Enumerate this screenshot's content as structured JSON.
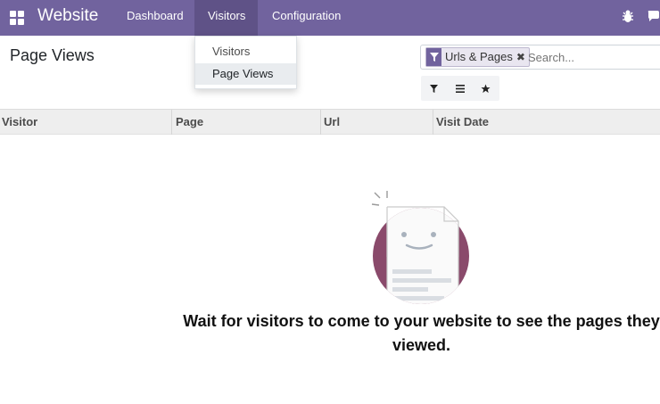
{
  "navbar": {
    "brand": "Website",
    "menu": [
      {
        "label": "Dashboard"
      },
      {
        "label": "Visitors"
      },
      {
        "label": "Configuration"
      }
    ],
    "icons": [
      "apps-grid-icon",
      "bug-icon",
      "chat-icon"
    ]
  },
  "dropdown": {
    "items": [
      {
        "label": "Visitors"
      },
      {
        "label": "Page Views"
      }
    ]
  },
  "page": {
    "title": "Page Views"
  },
  "search": {
    "facet_label": "Urls & Pages",
    "facet_icon": "filter-icon",
    "placeholder": "Search..."
  },
  "toolbar": {
    "buttons": [
      "filter-icon",
      "list-icon",
      "star-icon"
    ]
  },
  "table": {
    "columns": [
      "Visitor",
      "Page",
      "Url",
      "Visit Date"
    ]
  },
  "empty_state": {
    "message": "Wait for visitors to come to your website to see the pages they viewed."
  },
  "colors": {
    "navbar": "#71639e",
    "navbar_active": "#5f5287",
    "illustration_circle": "#8a4a6b"
  }
}
